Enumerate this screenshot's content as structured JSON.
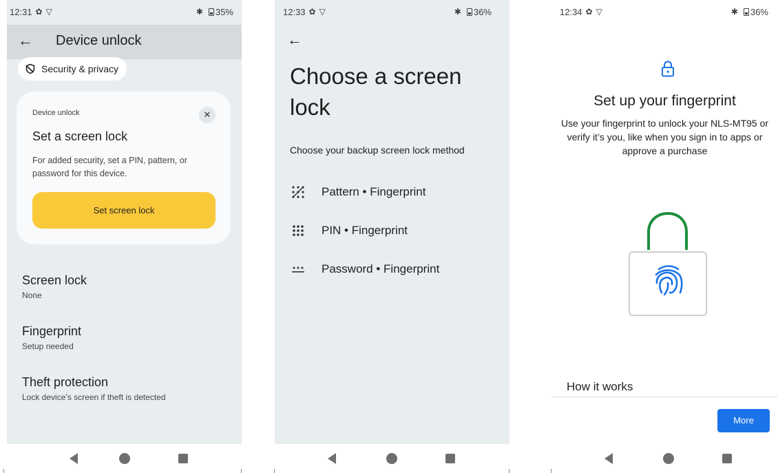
{
  "screens": [
    {
      "status": {
        "time": "12:31",
        "battery": "35%"
      },
      "appbar_title": "Device unlock",
      "chip_label": "Security & privacy",
      "card": {
        "eyebrow": "Device unlock",
        "title": "Set a screen lock",
        "description": "For added security, set a PIN, pattern, or password for this device.",
        "button": "Set screen lock"
      },
      "settings": [
        {
          "title": "Screen lock",
          "subtitle": "None"
        },
        {
          "title": "Fingerprint",
          "subtitle": "Setup needed"
        },
        {
          "title": "Theft protection",
          "subtitle": "Lock device’s screen if theft is detected"
        }
      ]
    },
    {
      "status": {
        "time": "12:33",
        "battery": "36%"
      },
      "title": "Choose a screen lock",
      "subtitle": "Choose your backup screen lock method",
      "options": [
        {
          "label": "Pattern • Fingerprint",
          "icon": "pattern-icon"
        },
        {
          "label": "PIN • Fingerprint",
          "icon": "pin-icon"
        },
        {
          "label": "Password • Fingerprint",
          "icon": "password-icon"
        }
      ]
    },
    {
      "status": {
        "time": "12:34",
        "battery": "36%"
      },
      "title": "Set up your fingerprint",
      "description": "Use your fingerprint to unlock your NLS-MT95 or verify it’s you, like when you sign in to apps or approve a purchase",
      "how_it_works": "How it works",
      "more_button": "More"
    }
  ],
  "colors": {
    "accent_yellow": "#f9c93a",
    "accent_blue": "#1a73e8",
    "shackle_green": "#1e8e3e",
    "settings_bg": "#e8edf0"
  }
}
